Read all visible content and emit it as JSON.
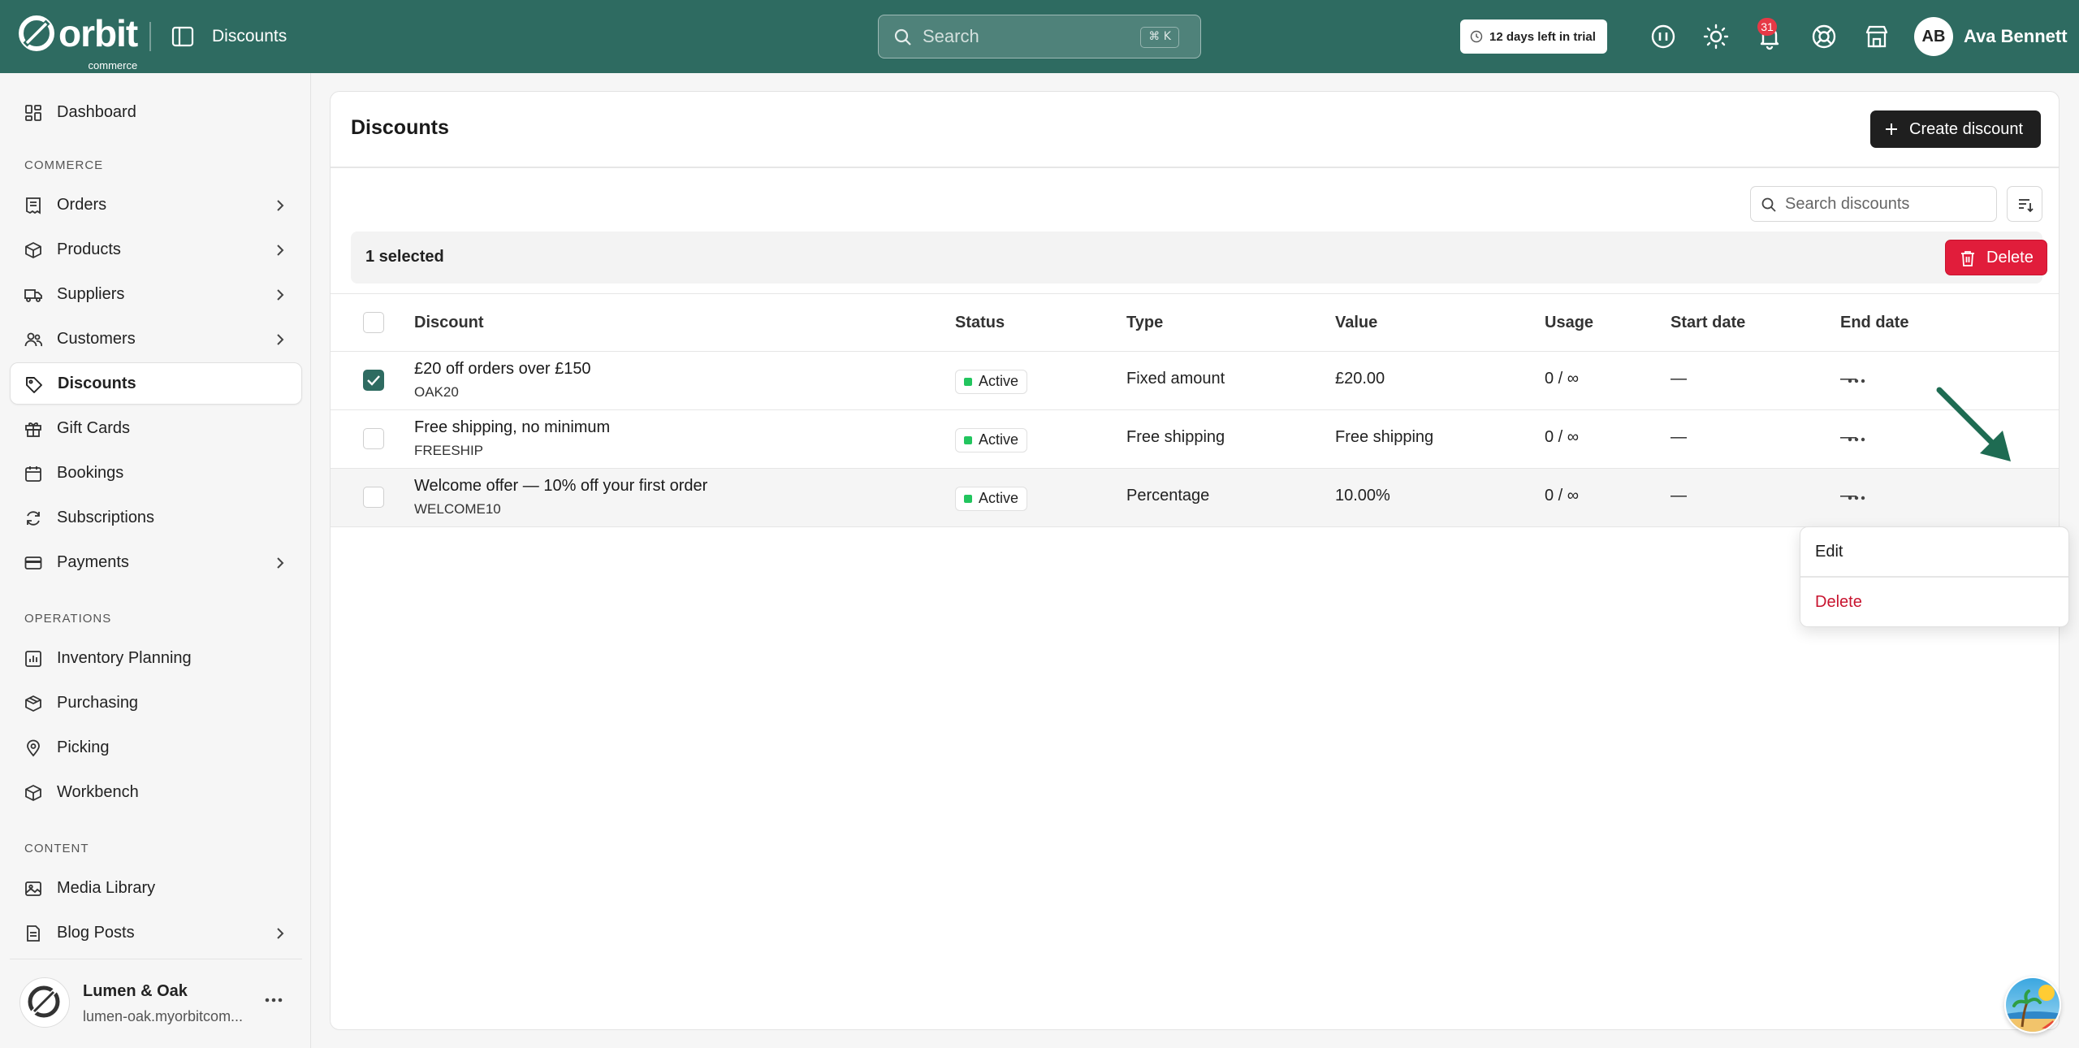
{
  "app": {
    "brand": "orbit",
    "brand_sub": "commerce",
    "page_title": "Discounts",
    "search_placeholder": "Search",
    "search_shortcut": "⌘ K",
    "trial_text": "12 days left in trial",
    "notification_count": "31",
    "user_initials": "AB",
    "user_name": "Ava Bennett",
    "accent_color": "#2e6b61"
  },
  "sidebar": {
    "dashboard": "Dashboard",
    "section_commerce": "COMMERCE",
    "orders": "Orders",
    "products": "Products",
    "suppliers": "Suppliers",
    "customers": "Customers",
    "discounts": "Discounts",
    "gift_cards": "Gift Cards",
    "bookings": "Bookings",
    "subscriptions": "Subscriptions",
    "payments": "Payments",
    "section_operations": "OPERATIONS",
    "inventory_planning": "Inventory Planning",
    "purchasing": "Purchasing",
    "picking": "Picking",
    "workbench": "Workbench",
    "section_content": "CONTENT",
    "media_library": "Media Library",
    "blog_posts": "Blog Posts",
    "store_name": "Lumen & Oak",
    "store_url": "lumen-oak.myorbitcom..."
  },
  "main": {
    "title": "Discounts",
    "create_label": "Create discount",
    "search_placeholder": "Search discounts",
    "selected_text": "1 selected",
    "delete_label": "Delete",
    "columns": {
      "discount": "Discount",
      "status": "Status",
      "type": "Type",
      "value": "Value",
      "usage": "Usage",
      "start": "Start date",
      "end": "End date"
    },
    "rows": [
      {
        "name": "£20 off orders over £150",
        "code": "OAK20",
        "status": "Active",
        "type": "Fixed amount",
        "value": "£20.00",
        "usage": "0 / ∞",
        "start": "—",
        "end": "—",
        "checked": true
      },
      {
        "name": "Free shipping, no minimum",
        "code": "FREESHIP",
        "status": "Active",
        "type": "Free shipping",
        "value": "Free shipping",
        "usage": "0 / ∞",
        "start": "—",
        "end": "—",
        "checked": false
      },
      {
        "name": "Welcome offer — 10% off your first order",
        "code": "WELCOME10",
        "status": "Active",
        "type": "Percentage",
        "value": "10.00%",
        "usage": "0 / ∞",
        "start": "—",
        "end": "—",
        "checked": false
      }
    ],
    "menu": {
      "edit": "Edit",
      "delete": "Delete"
    }
  }
}
